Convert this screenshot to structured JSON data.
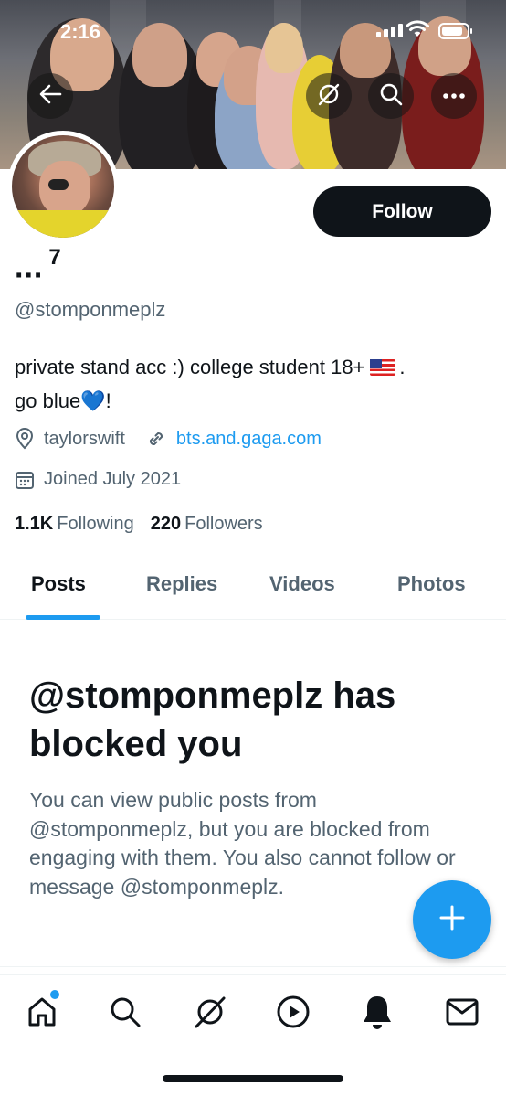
{
  "status_bar": {
    "time": "2:16"
  },
  "profile": {
    "display_name": "...",
    "display_name_suffix": "7",
    "handle": "@stomponmeplz",
    "bio_line1": "private stand acc :) college student 18+",
    "bio_line1_end": ".",
    "bio_line2_start": "go blue",
    "bio_line2_end": "!",
    "location": "taylorswift",
    "website": "bts.and.gaga.com",
    "joined": "Joined July 2021",
    "following_count": "1.1K",
    "following_label": "Following",
    "followers_count": "220",
    "followers_label": "Followers"
  },
  "actions": {
    "follow_label": "Follow"
  },
  "tabs": [
    {
      "label": "Posts",
      "active": true
    },
    {
      "label": "Replies",
      "active": false
    },
    {
      "label": "Videos",
      "active": false
    },
    {
      "label": "Photos",
      "active": false
    }
  ],
  "blocked": {
    "title": "@stomponmeplz has blocked you",
    "message": "You can view public posts from @stomponmeplz, but you are blocked from engaging with them. You also cannot follow or message @stomponmeplz."
  },
  "nav": {
    "items": [
      "home-icon",
      "search-icon",
      "grok-icon",
      "video-icon",
      "notifications-icon",
      "messages-icon"
    ],
    "home_has_badge": true
  },
  "colors": {
    "accent": "#1d9bf0",
    "text": "#0f1419",
    "secondary": "#536471",
    "button_dark": "#0f1419"
  },
  "icons": {
    "back": "back-arrow-icon",
    "grok": "grok-icon",
    "search": "search-icon",
    "more": "more-icon",
    "location": "location-pin-icon",
    "link": "link-icon",
    "calendar": "calendar-icon",
    "compose": "plus-icon"
  }
}
